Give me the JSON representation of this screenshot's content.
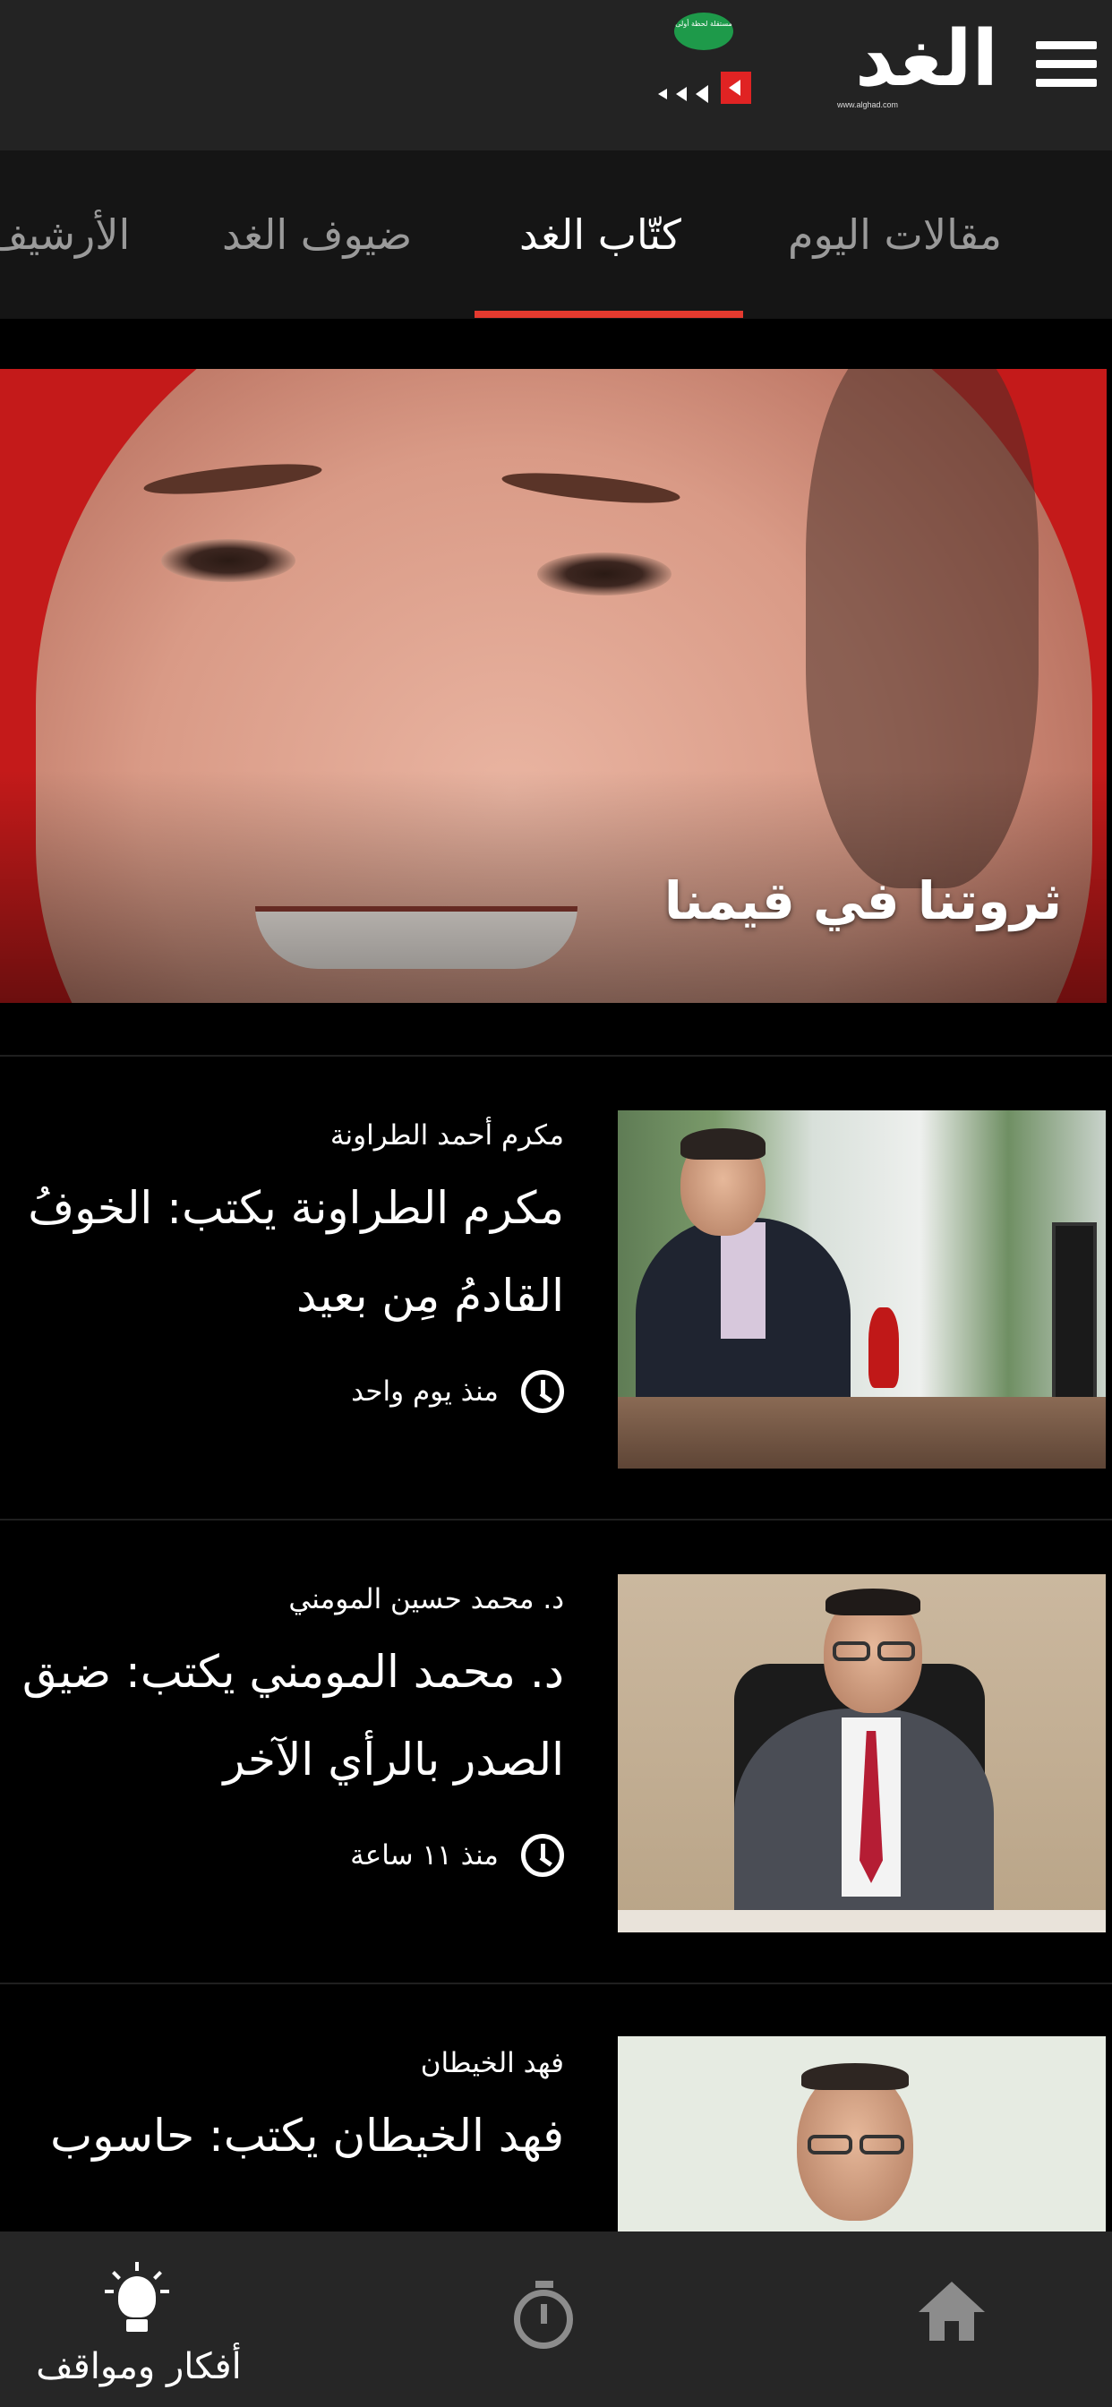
{
  "header": {
    "logo_text": "الغد",
    "logo_site": "www.alghad.com",
    "logo_badge": "مستقلة لحظة أولى",
    "menu_icon": "hamburger-menu-icon"
  },
  "tabs": [
    {
      "label": "مقالات اليوم",
      "active": false
    },
    {
      "label": "كتّاب الغد",
      "active": true
    },
    {
      "label": "ضيوف الغد",
      "active": false
    },
    {
      "label": "الأرشيف",
      "active": false
    }
  ],
  "accent_color": "#e43a2f",
  "hero": {
    "title": "ثروتنا في قيمنا"
  },
  "articles": [
    {
      "author": "مكرم أحمد الطراونة",
      "headline_line1": "مكرم الطراونة يكتب: الخوفُ",
      "headline_line2": "القادمُ مِن بعيد",
      "time": "منذ يوم واحد"
    },
    {
      "author": "د. محمد حسين المومني",
      "headline_line1": "د. محمد المومني يكتب: ضيق",
      "headline_line2": "الصدر بالرأي الآخر",
      "time": "منذ ١١ ساعة"
    },
    {
      "author": "فهد الخيطان",
      "headline_line1": "فهد الخيطان يكتب: حاسوب",
      "headline_line2": "",
      "time": ""
    }
  ],
  "bottom_nav": [
    {
      "label": "أفكار ومواقف",
      "icon": "lightbulb-icon",
      "active": true
    },
    {
      "label": "",
      "icon": "stopwatch-icon",
      "active": false
    },
    {
      "label": "",
      "icon": "home-icon",
      "active": false
    }
  ]
}
